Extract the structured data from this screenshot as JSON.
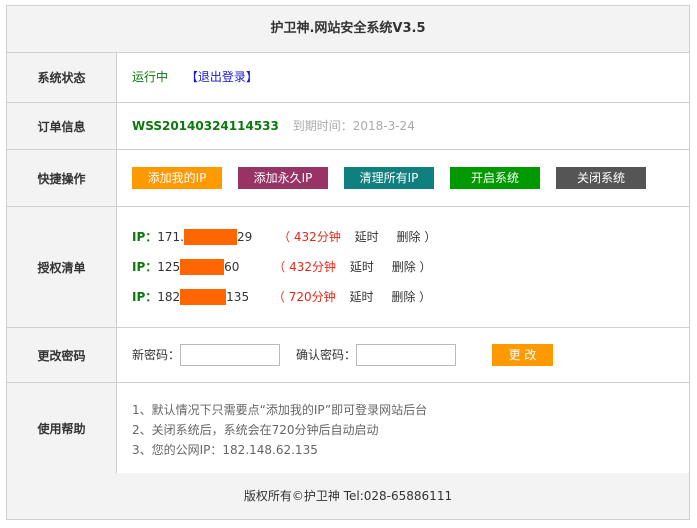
{
  "title": "护卫神.网站安全系统V3.5",
  "status": {
    "label": "系统状态",
    "value": "运行中",
    "logout": "【退出登录】"
  },
  "order": {
    "label": "订单信息",
    "id": "WSS20140324114533",
    "expire": "到期时间：2018-3-24"
  },
  "quick": {
    "label": "快捷操作",
    "buttons": [
      {
        "text": "添加我的IP",
        "color": "#ff9900"
      },
      {
        "text": "添加永久IP",
        "color": "#993366"
      },
      {
        "text": "清理所有IP",
        "color": "#0f7f80"
      },
      {
        "text": "开启系统",
        "color": "#009900"
      },
      {
        "text": "关闭系统",
        "color": "#555555"
      }
    ]
  },
  "whitelist": {
    "label": "授权清单",
    "items": [
      {
        "prefix": "IP：",
        "ip_start": "171.",
        "ip_end": "29",
        "duration": "（ 432分钟",
        "delay": "延时",
        "delete": "删除",
        "close": "）"
      },
      {
        "prefix": "IP：",
        "ip_start": "125",
        "ip_end": "60",
        "duration": "（ 432分钟",
        "delay": "延时",
        "delete": "删除",
        "close": "）"
      },
      {
        "prefix": "IP：",
        "ip_start": "182",
        "ip_end": "135",
        "duration": "（ 720分钟",
        "delay": "延时",
        "delete": "删除",
        "close": "）"
      }
    ]
  },
  "password": {
    "label": "更改密码",
    "new_label": "新密码：",
    "confirm_label": "确认密码：",
    "submit": "更 改",
    "new_value": "",
    "confirm_value": ""
  },
  "help": {
    "label": "使用帮助",
    "lines": [
      "1、默认情况下只需要点“添加我的IP”即可登录网站后台",
      "2、关闭系统后，系统会在720分钟后自动启动",
      "3、您的公网IP：182.148.62.135"
    ]
  },
  "footer": "版权所有©护卫神  Tel:028-65886111"
}
